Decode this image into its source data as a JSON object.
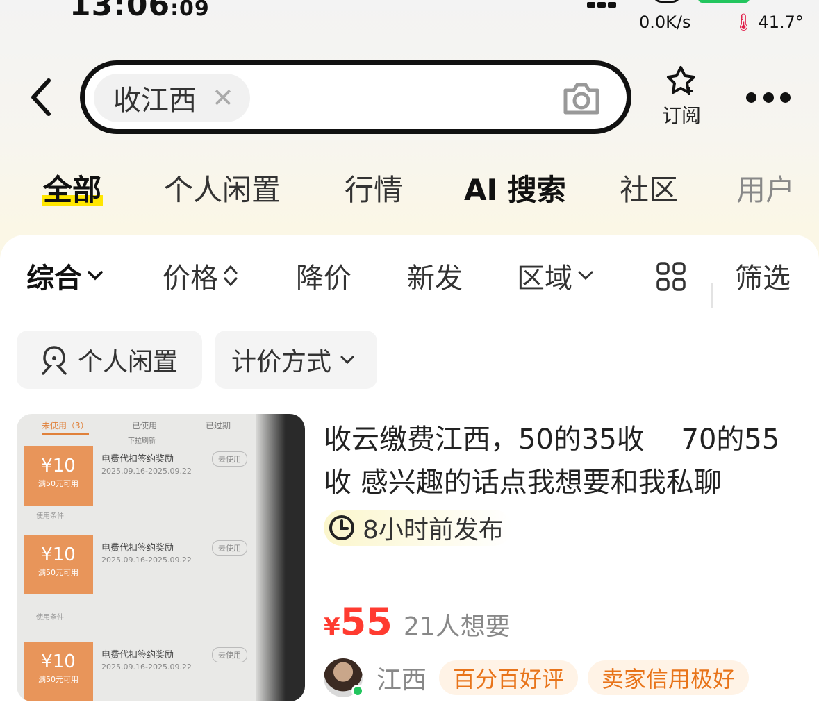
{
  "status_bar": {
    "clock_main": "13:06",
    "clock_seconds": ":09",
    "net_speed": "0.0K/s",
    "temperature": "41.7°"
  },
  "header": {
    "search_chip": "收江西",
    "subscribe_label": "订阅"
  },
  "categories": [
    {
      "label": "全部",
      "active": true
    },
    {
      "label": "个人闲置",
      "active": false
    },
    {
      "label": "行情",
      "active": false
    },
    {
      "label": "AI 搜索",
      "active": false
    },
    {
      "label": "社区",
      "active": false
    },
    {
      "label": "用户",
      "active": false
    }
  ],
  "sort_bar": {
    "comprehensive": "综合",
    "price": "价格",
    "price_drop": "降价",
    "new": "新发",
    "region": "区域",
    "filter": "筛选"
  },
  "filter_chips": {
    "personal": "个人闲置",
    "pricing": "计价方式"
  },
  "item": {
    "title": "收云缴费江西，50的35收　  70的55收 感兴趣的话点我想要和我私聊",
    "posted": "8小时前发布",
    "currency": "¥",
    "price": "55",
    "wants": "21人想要",
    "seller_name": "江西",
    "tags": [
      "百分百好评",
      "卖家信用极好"
    ],
    "image": {
      "tabs": [
        "未使用（3）",
        "已使用",
        "已过期"
      ],
      "pull_hint": "下拉刷新",
      "coupon_amount": "¥10",
      "coupon_condition": "满50元可用",
      "coupon_name": "电费代扣签约奖励",
      "coupon_dates": "2025.09.16-2025.09.22",
      "coupon_action": "去使用",
      "coupon_note": "使用条件"
    }
  },
  "colors": {
    "accent_yellow": "#ffe600",
    "price_red": "#ff3b30",
    "tag_orange": "#e8741a",
    "online_green": "#22c55e"
  }
}
